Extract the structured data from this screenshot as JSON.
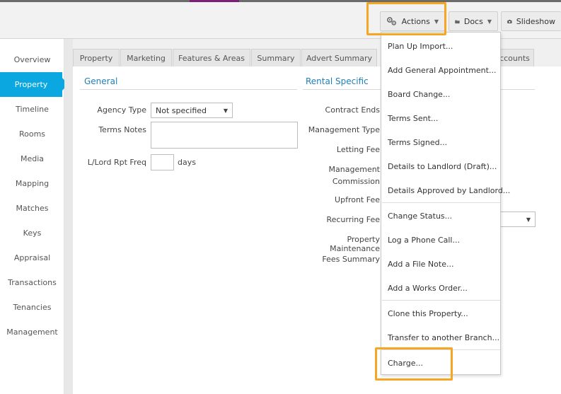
{
  "toolbar": {
    "actions_label": "Actions",
    "docs_label": "Docs",
    "slideshow_label": "Slideshow"
  },
  "sidebar": {
    "items": [
      {
        "label": "Overview"
      },
      {
        "label": "Property",
        "active": true
      },
      {
        "label": "Timeline"
      },
      {
        "label": "Rooms"
      },
      {
        "label": "Media"
      },
      {
        "label": "Mapping"
      },
      {
        "label": "Matches"
      },
      {
        "label": "Keys"
      },
      {
        "label": "Appraisal"
      },
      {
        "label": "Transactions"
      },
      {
        "label": "Tenancies"
      },
      {
        "label": "Management"
      }
    ]
  },
  "tabs": [
    {
      "label": "Property"
    },
    {
      "label": "Marketing"
    },
    {
      "label": "Features & Areas"
    },
    {
      "label": "Summary"
    },
    {
      "label": "Advert Summary"
    },
    {
      "label": "ccounts"
    }
  ],
  "general": {
    "title": "General",
    "agency_type_label": "Agency Type",
    "agency_type_value": "Not specified",
    "terms_notes_label": "Terms Notes",
    "lord_rpt_label": "L/Lord Rpt Freq",
    "days_label": "days"
  },
  "rental": {
    "title": "Rental Specific",
    "labels": [
      "Contract Ends",
      "Management Type",
      "Letting Fee",
      "Management",
      "Commission",
      "Upfront Fee",
      "Recurring Fee",
      "Property Maintenance",
      "Fees Summary"
    ]
  },
  "menu": {
    "items": [
      "Plan Up Import...",
      "Add General Appointment...",
      "Board Change...",
      "Terms Sent...",
      "Terms Signed...",
      "Details to Landlord (Draft)...",
      "Details Approved by Landlord...",
      "Change Status...",
      "Log a Phone Call...",
      "Add a File Note...",
      "Add a Works Order...",
      "Clone this Property...",
      "Transfer to another Branch...",
      "Charge..."
    ]
  },
  "colors": {
    "accent": "#0aa7e1",
    "highlight": "#f5a623",
    "section_title": "#1f7fb5"
  }
}
